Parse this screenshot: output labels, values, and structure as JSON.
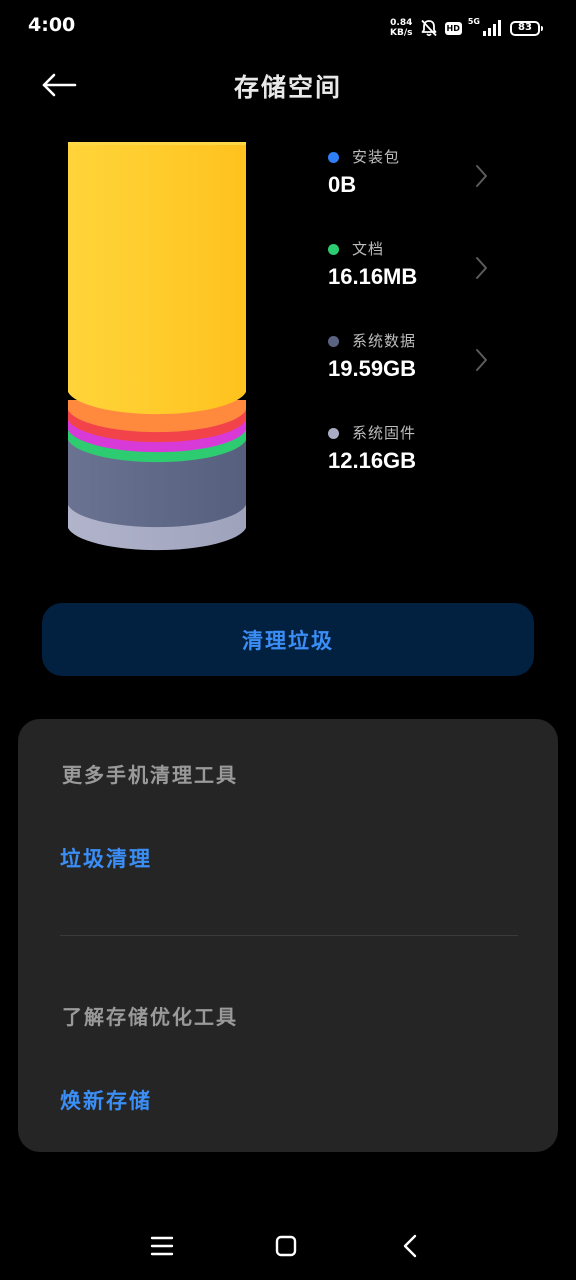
{
  "status_bar": {
    "time": "4:00",
    "net_speed_value": "0.84",
    "net_speed_unit": "KB/s",
    "hd_label": "HD",
    "network_type": "5G",
    "battery_level": "83"
  },
  "header": {
    "title": "存储空间"
  },
  "storage_chart": {
    "segments": [
      {
        "name": "安装包",
        "value_bytes": 0,
        "color": "#2f7ef5"
      },
      {
        "name": "文档",
        "value_mb": 16.16,
        "color": "#2ecc71"
      },
      {
        "name": "系统数据",
        "value_gb": 19.59,
        "color": "#5a6482"
      },
      {
        "name": "系统固件",
        "value_gb": 12.16,
        "color": "#a8acc4"
      }
    ],
    "colors": {
      "used_top": "#ffc82e",
      "band_orange": "#ff8a3d",
      "band_red": "#f2424a",
      "band_magenta": "#d83ad8",
      "band_green": "#2ecc71",
      "system_data": "#5a6482",
      "firmware": "#a8acc4"
    }
  },
  "legend": {
    "items": [
      {
        "label": "安装包",
        "value": "0B",
        "color": "#2f7ef5",
        "has_chevron": true
      },
      {
        "label": "文档",
        "value": "16.16MB",
        "color": "#2ecc71",
        "has_chevron": true
      },
      {
        "label": "系统数据",
        "value": "19.59GB",
        "color": "#5a6482",
        "has_chevron": true
      },
      {
        "label": "系统固件",
        "value": "12.16GB",
        "color": "#a8acc4",
        "has_chevron": false
      }
    ]
  },
  "clean_button": {
    "label": "清理垃圾"
  },
  "tools_card": {
    "section1_title": "更多手机清理工具",
    "section1_link": "垃圾清理",
    "section2_title": "了解存储优化工具",
    "section2_link": "焕新存储"
  },
  "icons": {
    "back": "arrow-left-icon",
    "chevron": "chevron-right-icon",
    "menu": "menu-icon",
    "home": "home-square-icon",
    "nav_back": "chevron-left-icon"
  },
  "theme": {
    "background": "#000000",
    "card_background": "#252525",
    "accent": "#3a8ef6",
    "button_background": "#02203f"
  }
}
